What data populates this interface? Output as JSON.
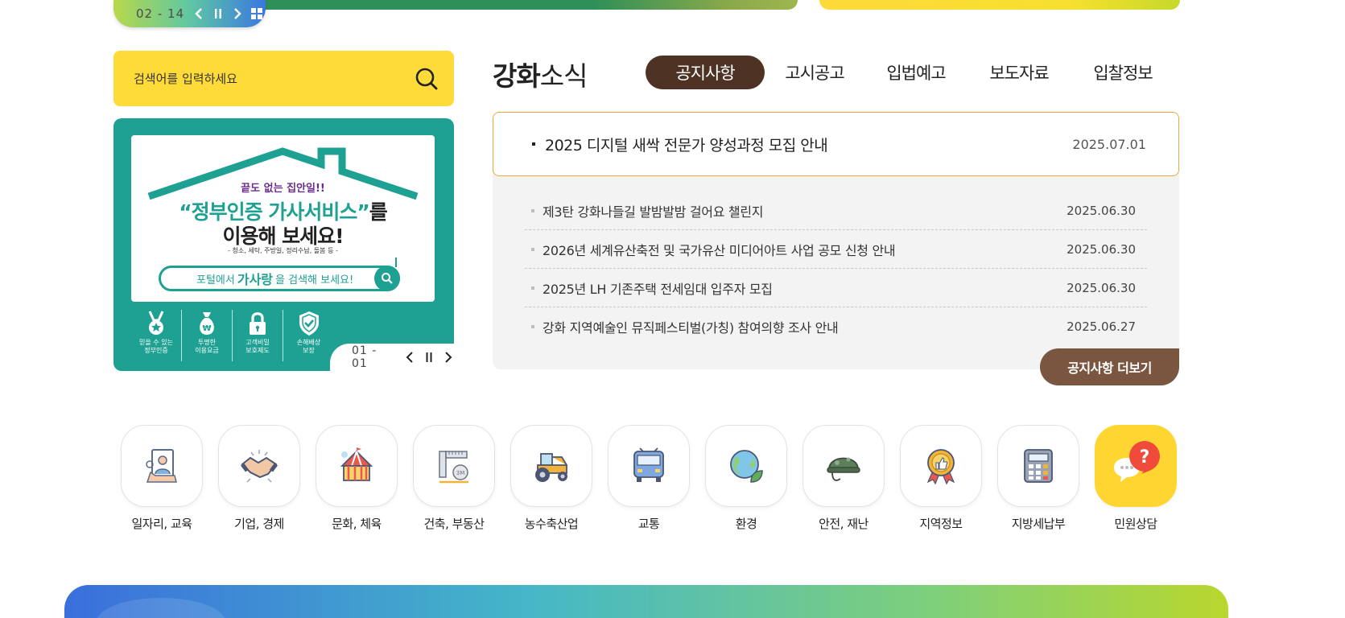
{
  "top_slider": {
    "counter": "02 - 14"
  },
  "search": {
    "placeholder": "검색어를 입력하세요"
  },
  "banner": {
    "line1": "끝도 없는 집안일!!",
    "line2_highlight": "“정부인증 가사서비스”",
    "line2_rest": "를",
    "line3": "이용해 보세요!",
    "line4": "- 청소, 세탁, 주방일, 정리수납, 돌봄 등 -",
    "pill_prefix": "포털에서",
    "pill_keyword": "가사랑",
    "pill_suffix": "을 검색해 보세요!",
    "features": [
      {
        "icon": "medal-icon",
        "label": "믿을 수 있는\n정부인증"
      },
      {
        "icon": "money-bag-icon",
        "label": "투명한\n이용요금"
      },
      {
        "icon": "lock-icon",
        "label": "고객비밀\n보호제도"
      },
      {
        "icon": "shield-check-icon",
        "label": "손해배상\n보장"
      }
    ],
    "counter": "01 - 01"
  },
  "news": {
    "title_bold": "강화",
    "title_light": "소식",
    "tabs": [
      "공지사항",
      "고시공고",
      "입법예고",
      "보도자료",
      "입찰정보"
    ],
    "active_tab": 0,
    "featured": {
      "title": "2025 디지털 새싹 전문가 양성과정 모집 안내",
      "date": "2025.07.01"
    },
    "items": [
      {
        "title": "제3탄 강화나들길 발밤발밤 걸어요 챌린지",
        "date": "2025.06.30"
      },
      {
        "title": "2026년 세계유산축전 및 국가유산 미디어아트 사업 공모 신청 안내",
        "date": "2025.06.30"
      },
      {
        "title": "2025년 LH 기존주택 전세임대 입주자 모집",
        "date": "2025.06.30"
      },
      {
        "title": "강화 지역예술인 뮤직페스티벌(가칭) 참여의향 조사 안내",
        "date": "2025.06.27"
      }
    ],
    "more_label": "공지사항 더보기"
  },
  "quick_menu": [
    {
      "label": "일자리, 교육",
      "icon": "job-certificate-icon"
    },
    {
      "label": "기업, 경제",
      "icon": "handshake-icon"
    },
    {
      "label": "문화, 체육",
      "icon": "circus-tent-icon"
    },
    {
      "label": "건축, 부동산",
      "icon": "ruler-tape-icon"
    },
    {
      "label": "농수축산업",
      "icon": "tractor-icon"
    },
    {
      "label": "교통",
      "icon": "bus-icon"
    },
    {
      "label": "환경",
      "icon": "earth-leaf-icon"
    },
    {
      "label": "안전, 재난",
      "icon": "helmet-icon"
    },
    {
      "label": "지역정보",
      "icon": "badge-thumbs-up-icon"
    },
    {
      "label": "지방세납부",
      "icon": "calculator-icon"
    },
    {
      "label": "민원상담",
      "icon": "chat-question-icon"
    }
  ],
  "colors": {
    "accent_yellow": "#ffdb3a",
    "banner_teal": "#1ea193",
    "tab_active_brown": "#4e3223",
    "more_button_brown": "#7a5640",
    "featured_border": "#f0a83b"
  }
}
